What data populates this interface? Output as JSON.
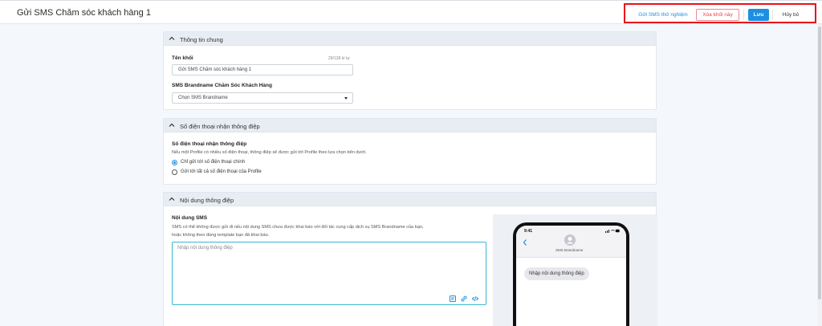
{
  "header": {
    "title": "Gửi SMS Chăm sóc khách hàng 1",
    "actions": {
      "test_label": "Gửi SMS thử nghiệm",
      "delete_label": "Xóa khối này",
      "save_label": "Lưu",
      "cancel_label": "Hủy bỏ"
    }
  },
  "general": {
    "section_title": "Thông tin chung",
    "name_label": "Tên khối",
    "name_counter": "29/128 kí tự",
    "name_value": "Gửi SMS Chăm sóc khách hàng 1",
    "brandname_label": "SMS Brandname Chăm Sóc Khách Hàng",
    "brandname_value": "Chọn SMS Brandname"
  },
  "phone": {
    "section_title": "Số điện thoại nhận thông điệp",
    "label": "Số điện thoại nhận thông điệp",
    "help": "Nếu một Profile có nhiều số điện thoại, thông điệp sẽ được gửi tới Profile theo lựa chọn bên dưới.",
    "options": [
      {
        "label": "Chỉ gửi tới số điện thoại chính",
        "selected": true
      },
      {
        "label": "Gửi tới tất cả số điện thoại của Profile",
        "selected": false
      }
    ]
  },
  "content": {
    "section_title": "Nội dung thông điệp",
    "label": "Nội dung SMS",
    "help_line1": "SMS có thể không được gửi đi nếu nội dung SMS chưa được khai báo với đối tác cung cấp dịch vụ SMS Brandname của bạn,",
    "help_line2": "hoặc không theo đúng template bạn đã khai báo.",
    "placeholder": "Nhập nội dung thông điệp",
    "toolbar_icons": [
      "template-icon",
      "link-icon",
      "code-icon"
    ]
  },
  "preview": {
    "time": "9:41",
    "brandname": "SMS Brandname",
    "message": "Nhập nội dung thông điệp"
  },
  "colors": {
    "accent": "#1d8fe1",
    "danger": "#e8454c",
    "highlight_box": "#e8121c",
    "input_focus": "#37b7d3"
  }
}
